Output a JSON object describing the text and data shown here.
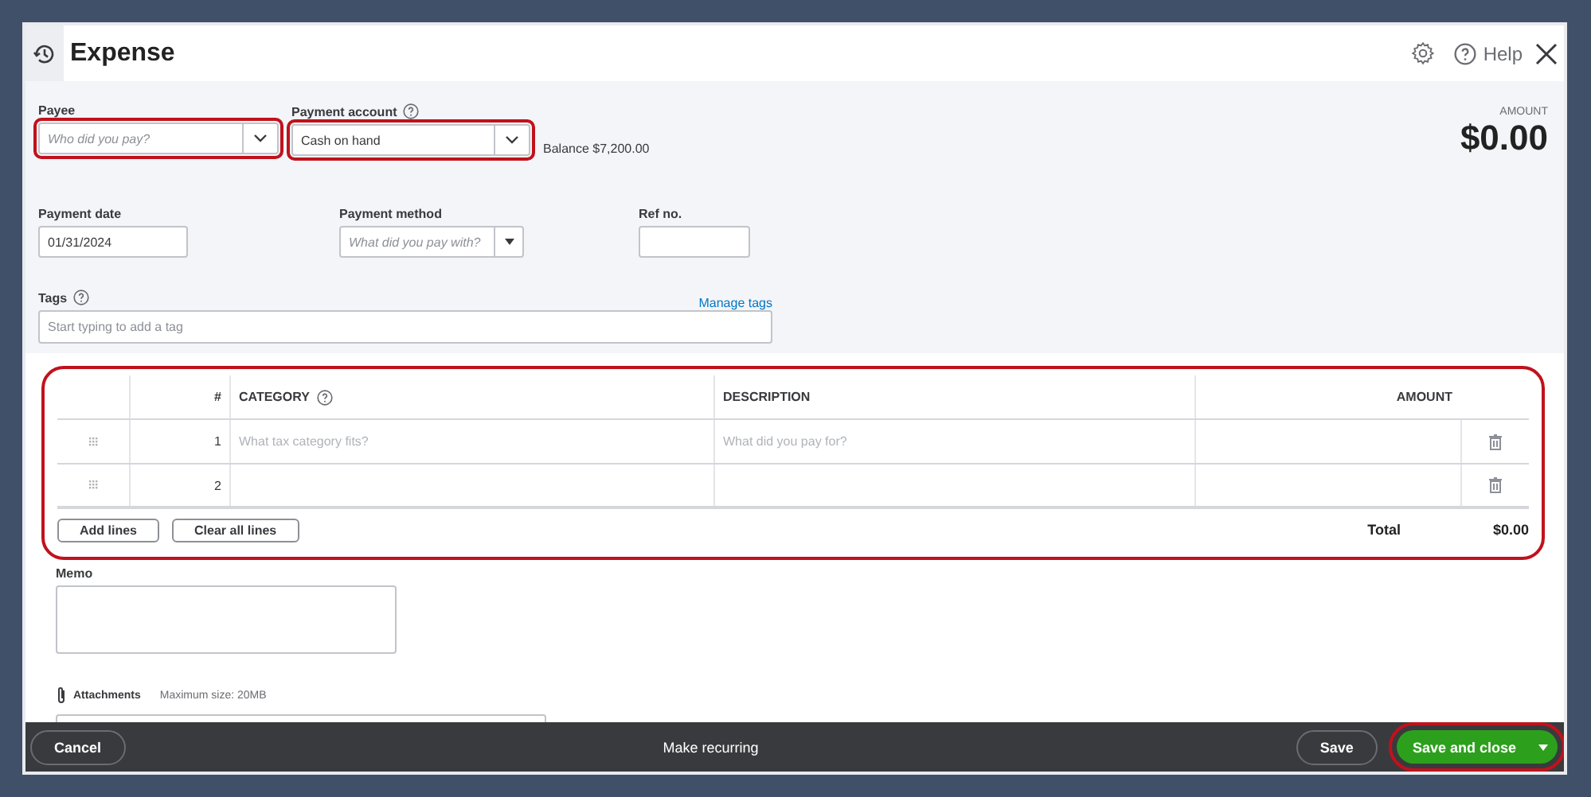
{
  "window": {
    "title": "Expense",
    "help": "Help"
  },
  "form": {
    "payee": {
      "label": "Payee",
      "placeholder": "Who did you pay?",
      "highlighted": true
    },
    "payment_account": {
      "label": "Payment account",
      "value": "Cash on hand",
      "highlighted": true
    },
    "balance": "Balance $7,200.00",
    "amount": {
      "label": "AMOUNT",
      "value": "$0.00"
    },
    "payment_date": {
      "label": "Payment date",
      "value": "01/31/2024"
    },
    "payment_method": {
      "label": "Payment method",
      "placeholder": "What did you pay with?"
    },
    "ref_no": {
      "label": "Ref no."
    },
    "tags": {
      "label": "Tags",
      "placeholder": "Start typing to add a tag",
      "link": "Manage tags"
    }
  },
  "table": {
    "highlighted": true,
    "columns": [
      "#",
      "CATEGORY",
      "DESCRIPTION",
      "AMOUNT"
    ],
    "rows": [
      {
        "number": "1",
        "category_placeholder": "What tax category fits?",
        "description_placeholder": "What did you pay for?"
      },
      {
        "number": "2"
      }
    ],
    "buttons": [
      "Add lines",
      "Clear all lines"
    ],
    "total_label": "Total",
    "total": "$0.00"
  },
  "memo": {
    "label": "Memo"
  },
  "attachments": {
    "label": "Attachments",
    "note": "Maximum size: 20MB"
  },
  "footer": {
    "cancel": "Cancel",
    "recurring": "Make recurring",
    "save": "Save",
    "save_close": {
      "label": "Save and close",
      "highlighted": true
    }
  }
}
